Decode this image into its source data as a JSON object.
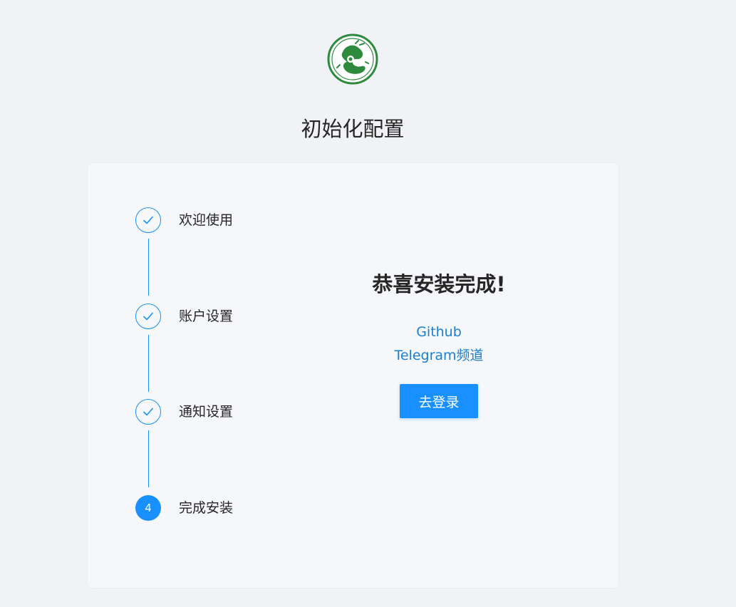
{
  "header": {
    "logo_icon": "qilin-seal-logo",
    "title": "初始化配置"
  },
  "steps": [
    {
      "label": "欢迎使用",
      "status": "done",
      "icon": "check-icon"
    },
    {
      "label": "账户设置",
      "status": "done",
      "icon": "check-icon"
    },
    {
      "label": "通知设置",
      "status": "done",
      "icon": "check-icon"
    },
    {
      "label": "完成安装",
      "status": "active",
      "number": "4"
    }
  ],
  "content": {
    "title": "恭喜安装完成!",
    "links": [
      "Github",
      "Telegram频道"
    ],
    "login_button": "去登录"
  },
  "colors": {
    "primary": "#1890ff",
    "background": "#f0f2f5",
    "card": "#f5f7fa",
    "logo_green": "#2e8b3e"
  }
}
